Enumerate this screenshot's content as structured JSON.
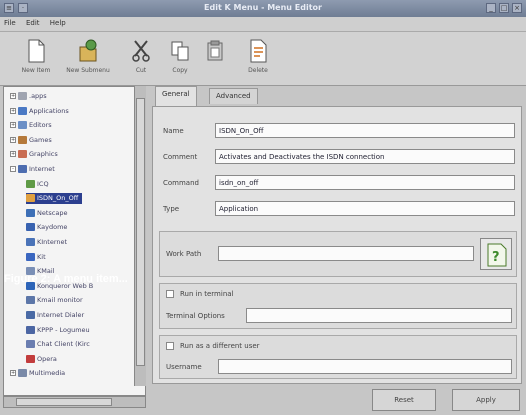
{
  "window": {
    "title": "Edit K Menu - Menu Editor"
  },
  "menubar": [
    "File",
    "Edit",
    "Help"
  ],
  "toolbar": [
    {
      "label": "New Item",
      "icon": "new-item-icon"
    },
    {
      "label": "New Submenu",
      "icon": "new-submenu-icon"
    },
    {
      "label": "Cut",
      "icon": "cut-icon"
    },
    {
      "label": "Copy",
      "icon": "copy-icon"
    },
    {
      "label": "",
      "icon": "paste-icon"
    },
    {
      "label": "Delete",
      "icon": "delete-icon"
    }
  ],
  "tree": [
    {
      "label": ".apps",
      "expander": "+",
      "icon": "folder-icon",
      "color": "#9fa4b0"
    },
    {
      "label": "Applications",
      "expander": "+",
      "icon": "applications-icon",
      "color": "#4a79c4"
    },
    {
      "label": "Editors",
      "expander": "+",
      "icon": "editors-icon",
      "color": "#6b8fc6"
    },
    {
      "label": "Games",
      "expander": "+",
      "icon": "games-icon",
      "color": "#b5793a"
    },
    {
      "label": "Graphics",
      "expander": "+",
      "icon": "graphics-icon",
      "color": "#c86c52"
    },
    {
      "label": "Internet",
      "expander": "-",
      "icon": "internet-icon",
      "color": "#4d6db0"
    },
    {
      "label": "ICQ",
      "expander": "",
      "icon": "icq-icon",
      "color": "#5f9a46"
    },
    {
      "label": "ISDN_On_Off",
      "expander": "",
      "icon": "isdn-icon",
      "color": "#e0a040",
      "selected": true
    },
    {
      "label": "Netscape",
      "expander": "",
      "icon": "netscape-icon",
      "color": "#3d6fb6"
    },
    {
      "label": "Kaydome",
      "expander": "",
      "icon": "kaydome-icon",
      "color": "#3862b0"
    },
    {
      "label": "KInternet",
      "expander": "",
      "icon": "kinternet-icon",
      "color": "#4a73b8"
    },
    {
      "label": "Kit",
      "expander": "",
      "icon": "kit-icon",
      "color": "#3a66c0"
    },
    {
      "label": "KMail",
      "expander": "",
      "icon": "kmail-icon",
      "color": "#7a8fb6"
    },
    {
      "label": "Konqueror Web B",
      "expander": "",
      "icon": "konqueror-icon",
      "color": "#2d64b8"
    },
    {
      "label": "Kmail monitor",
      "expander": "",
      "icon": "kmail-monitor-icon",
      "color": "#5c76a8"
    },
    {
      "label": "Internet Dialer",
      "expander": "",
      "icon": "dialer-icon",
      "color": "#4a6aa5"
    },
    {
      "label": "KPPP - Logumeu",
      "expander": "",
      "icon": "kppp-icon",
      "color": "#4c66a3"
    },
    {
      "label": "Chat Client (Kirc",
      "expander": "",
      "icon": "chat-icon",
      "color": "#6a7db0"
    },
    {
      "label": "Opera",
      "expander": "",
      "icon": "opera-icon",
      "color": "#c23c3c"
    },
    {
      "label": "Multimedia",
      "expander": "+",
      "icon": "multimedia-icon",
      "color": "#7a8aa8"
    }
  ],
  "tabs": [
    "General",
    "Advanced"
  ],
  "general": {
    "name_label": "Name",
    "name_value": "ISDN_On_Off",
    "comment_label": "Comment",
    "comment_value": "Activates and Deactivates the ISDN connection",
    "command_label": "Command",
    "command_value": "isdn_on_off",
    "type_label": "Type",
    "type_value": "Application",
    "workpath_label": "Work Path",
    "workpath_value": "",
    "run_in_terminal_label": "Run in terminal",
    "terminal_options_label": "Terminal Options",
    "different_user_label": "Run as a different user",
    "username_label": "Username"
  },
  "caption": "Figure 2: A menu item...",
  "buttons": {
    "reset": "Reset",
    "apply": "Apply"
  }
}
